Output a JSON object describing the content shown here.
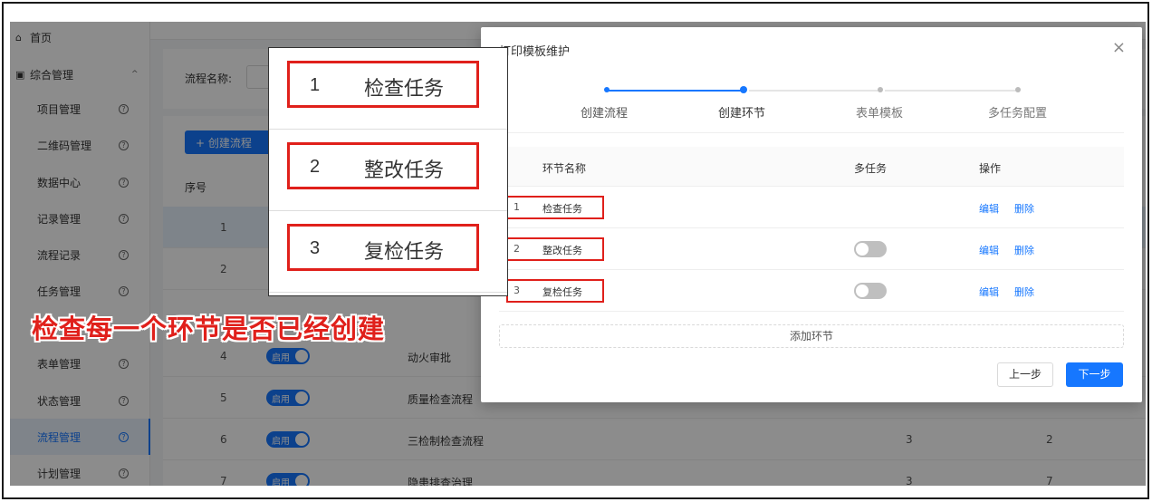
{
  "sidebar": {
    "home": "首页",
    "group": "综合管理",
    "items": [
      {
        "label": "项目管理"
      },
      {
        "label": "二维码管理"
      },
      {
        "label": "数据中心"
      },
      {
        "label": "记录管理"
      },
      {
        "label": "流程记录"
      },
      {
        "label": "任务管理"
      },
      {
        "label": "表单管理"
      },
      {
        "label": "状态管理"
      },
      {
        "label": "流程管理"
      },
      {
        "label": "计划管理"
      }
    ]
  },
  "main": {
    "filter_label": "流程名称:",
    "create_button": "+ 创建流程",
    "col_seq": "序号",
    "switch_label": "启用",
    "rows": [
      {
        "seq": "1",
        "name": "",
        "c5": "",
        "c6": ""
      },
      {
        "seq": "2",
        "name": "",
        "c5": "",
        "c6": ""
      },
      {
        "seq": "4",
        "name": "动火审批",
        "c5": "",
        "c6": ""
      },
      {
        "seq": "5",
        "name": "质量检查流程",
        "c5": "",
        "c6": ""
      },
      {
        "seq": "6",
        "name": "三检制检查流程",
        "c5": "3",
        "c6": "2"
      },
      {
        "seq": "7",
        "name": "隐患排查治理",
        "c5": "3",
        "c6": "7"
      }
    ]
  },
  "dialog": {
    "title": "打印模板维护",
    "close": "×",
    "steps": [
      "创建流程",
      "创建环节",
      "表单模板",
      "多任务配置"
    ],
    "active_step": 1,
    "columns": {
      "name": "环节名称",
      "multi": "多任务",
      "ops": "操作"
    },
    "rows": [
      {
        "index": "1",
        "name": "检查任务",
        "has_toggle": false
      },
      {
        "index": "2",
        "name": "整改任务",
        "has_toggle": true
      },
      {
        "index": "3",
        "name": "复检任务",
        "has_toggle": true
      }
    ],
    "edit": "编辑",
    "delete": "删除",
    "add_node": "添加环节",
    "prev": "上一步",
    "next": "下一步"
  },
  "zoom": [
    {
      "index": "1",
      "name": "检查任务"
    },
    {
      "index": "2",
      "name": "整改任务"
    },
    {
      "index": "3",
      "name": "复检任务"
    }
  ],
  "caption": "检查每一个环节是否已经创建",
  "colors": {
    "accent": "#1677ff",
    "annotation": "#e0201b"
  }
}
